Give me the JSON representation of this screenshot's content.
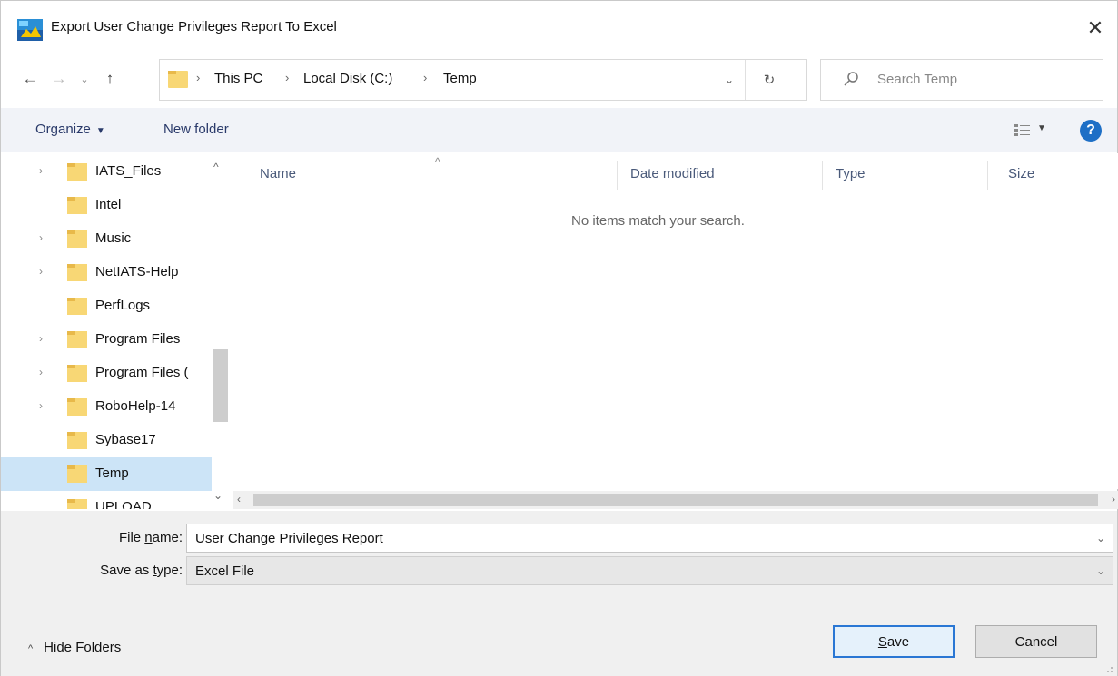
{
  "window": {
    "title": "Export User Change Privileges Report To Excel",
    "close_glyph": "✕",
    "icon": "excel-export-app-icon"
  },
  "navigation": {
    "back_glyph": "←",
    "forward_glyph": "→",
    "recent_glyph": "⌄",
    "up_glyph": "↑",
    "breadcrumbs": [
      "This PC",
      "Local Disk (C:)",
      "Temp"
    ],
    "separator": "›",
    "dropdown_glyph": "⌄",
    "refresh_glyph": "↻"
  },
  "search": {
    "placeholder": "Search Temp"
  },
  "toolbar": {
    "organize_label": "Organize",
    "organize_caret": "▼",
    "new_folder_label": "New folder",
    "view_caret": "▼",
    "help_label": "?"
  },
  "nav_pane": {
    "items": [
      {
        "label": "IATS_Files",
        "expander": "›",
        "selected": false
      },
      {
        "label": "Intel",
        "expander": "",
        "selected": false
      },
      {
        "label": "Music",
        "expander": "›",
        "selected": false
      },
      {
        "label": "NetIATS-Help",
        "expander": "›",
        "selected": false
      },
      {
        "label": "PerfLogs",
        "expander": "",
        "selected": false
      },
      {
        "label": "Program Files",
        "expander": "›",
        "selected": false
      },
      {
        "label": "Program Files (",
        "expander": "›",
        "selected": false
      },
      {
        "label": "RoboHelp-14",
        "expander": "›",
        "selected": false
      },
      {
        "label": "Sybase17",
        "expander": "",
        "selected": false
      },
      {
        "label": "Temp",
        "expander": "",
        "selected": true
      },
      {
        "label": "UPLOAD",
        "expander": "",
        "selected": false
      }
    ],
    "scroll_up_glyph": "^",
    "scroll_down_glyph": "⌄"
  },
  "file_list": {
    "sort_glyph": "^",
    "columns": [
      "Name",
      "Date modified",
      "Type",
      "Size"
    ],
    "empty_message": "No items match your search.",
    "scroll_left_glyph": "‹",
    "scroll_right_glyph": "›"
  },
  "form": {
    "file_name_label_pre": "File ",
    "file_name_label_u": "n",
    "file_name_label_post": "ame:",
    "file_name_value": "User Change Privileges Report",
    "save_type_label_pre": "Save as ",
    "save_type_label_u": "t",
    "save_type_label_post": "ype:",
    "save_type_value": "Excel File",
    "caret_glyph": "⌄"
  },
  "footer": {
    "hide_folders_chevron": "^",
    "hide_folders_label": "Hide Folders",
    "save_label_u": "S",
    "save_label_rest": "ave",
    "cancel_label": "Cancel"
  }
}
